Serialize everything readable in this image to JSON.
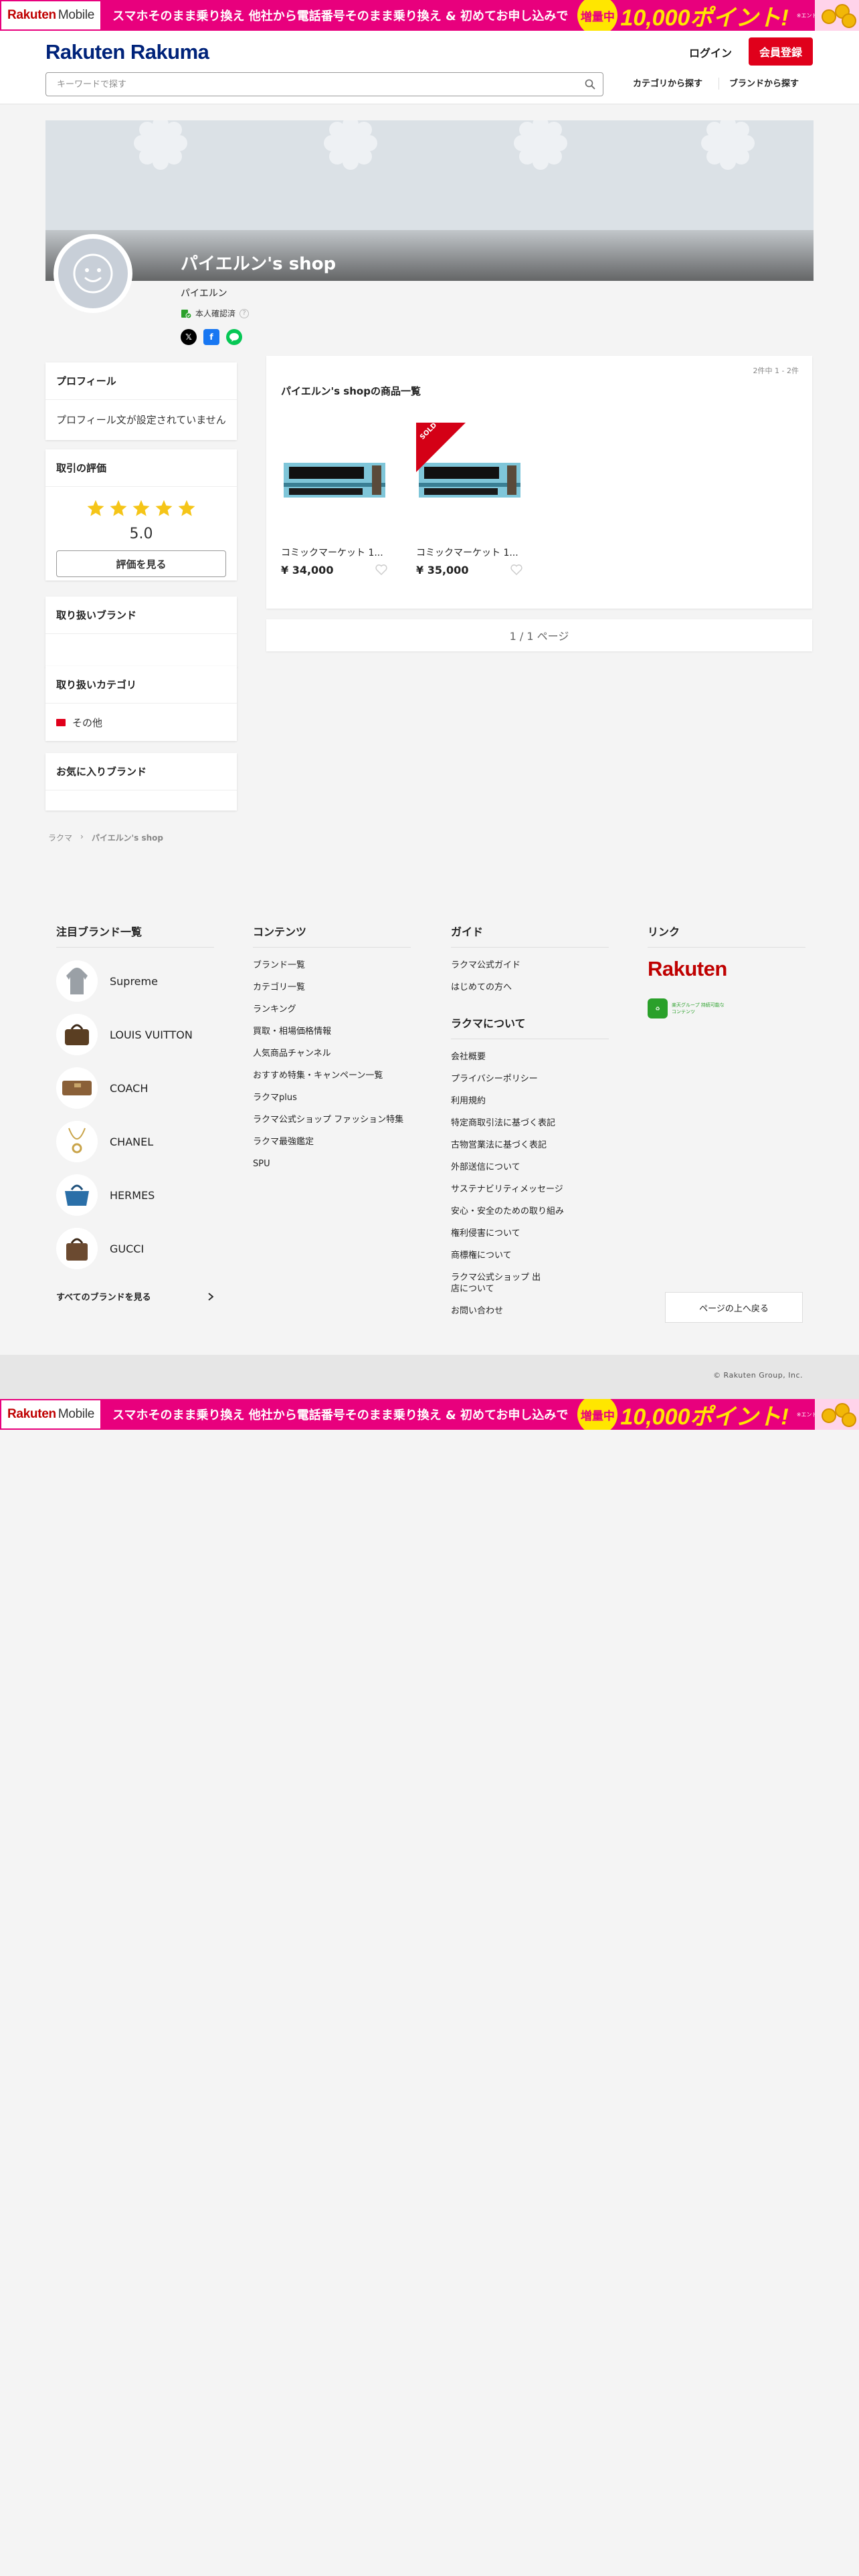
{
  "promo": {
    "logo_main": "Rakuten",
    "logo_sub": "Mobile",
    "text": "スマホそのまま乗り換え 他社から電話番号そのまま乗り換え & 初めてお申し込みで",
    "badge": "増量中",
    "points": "10,000ポイント!",
    "small": "※エントリー等条件あり"
  },
  "header": {
    "brand": "Rakuten",
    "brand_sub": "Rakuma",
    "login": "ログイン",
    "signup": "会員登録",
    "search_placeholder": "キーワードで探す",
    "nav_category": "カテゴリから探す",
    "nav_brand": "ブランドから探す"
  },
  "shop": {
    "title": "パイエルン's shop",
    "owner": "パイエルン",
    "verified": "本人確認済",
    "verified_help": "?"
  },
  "sidebar": {
    "profile_title": "プロフィール",
    "profile_text": "プロフィール文が設定されていません",
    "rating_title": "取引の評価",
    "rating_stars": 5,
    "rating_score": "5.0",
    "rating_button": "評価を見る",
    "brands_title": "取り扱いブランド",
    "categories_title": "取り扱いカテゴリ",
    "category_items": [
      "その他"
    ],
    "favorites_title": "お気に入りブランド"
  },
  "products": {
    "count": "2件中 1 - 2件",
    "title": "パイエルン's shopの商品一覧",
    "items": [
      {
        "name": "コミックマーケット 1...",
        "price": "¥ 34,000",
        "sold_out": false
      },
      {
        "name": "コミックマーケット 1...",
        "price": "¥ 35,000",
        "sold_out": true
      }
    ],
    "sold_label": "SOLD OUT",
    "pager": "1 / 1 ページ"
  },
  "breadcrumb": {
    "home": "ラクマ",
    "sep": "›",
    "current": "パイエルン's shop"
  },
  "footer": {
    "brands_title": "注目ブランド一覧",
    "brands": [
      "Supreme",
      "LOUIS VUITTON",
      "COACH",
      "CHANEL",
      "HERMES",
      "GUCCI"
    ],
    "all_brands": "すべてのブランドを見る",
    "contents_title": "コンテンツ",
    "contents": [
      "ブランド一覧",
      "カテゴリ一覧",
      "ランキング",
      "買取・相場価格情報",
      "人気商品チャンネル",
      "おすすめ特集・キャンペーン一覧",
      "ラクマplus",
      "ラクマ公式ショップ ファッション特集",
      "ラクマ最強鑑定",
      "SPU"
    ],
    "guide_title": "ガイド",
    "guide": [
      "ラクマ公式ガイド",
      "はじめての方へ"
    ],
    "about_title": "ラクマについて",
    "about": [
      "会社概要",
      "プライバシーポリシー",
      "利用規約",
      "特定商取引法に基づく表記",
      "古物営業法に基づく表記",
      "外部送信について",
      "サステナビリティメッセージ",
      "安心・安全のための取り組み",
      "権利侵害について",
      "商標権について",
      "ラクマ公式ショップ 出店について",
      "お問い合わせ"
    ],
    "links_title": "リンク",
    "rakuten_logo": "Rakuten",
    "green_logo_text": "楽天グループ 持続可能なコンテンツ",
    "to_top": "ページの上へ戻る",
    "copyright": "© Rakuten Group, Inc."
  },
  "colors": {
    "brand_blue": "#00237a",
    "signup_red": "#e0001b",
    "promo_pink": "#e8007d",
    "star_yellow": "#f5c518"
  }
}
